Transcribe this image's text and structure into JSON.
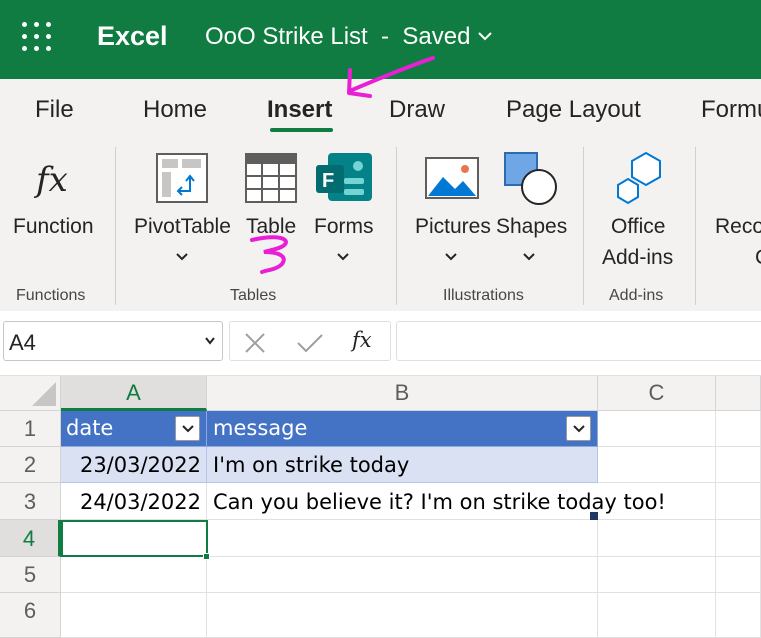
{
  "title_bar": {
    "app_name": "Excel",
    "doc_title": "OoO Strike List  -  Saved",
    "brand_color": "#107c41"
  },
  "ribbon_tabs": [
    {
      "label": "File",
      "active": false
    },
    {
      "label": "Home",
      "active": false
    },
    {
      "label": "Insert",
      "active": true
    },
    {
      "label": "Draw",
      "active": false
    },
    {
      "label": "Page Layout",
      "active": false
    },
    {
      "label": "Formu",
      "active": false
    }
  ],
  "ribbon": {
    "function_label": "Function",
    "pivottable_label": "PivotTable",
    "table_label": "Table",
    "forms_label": "Forms",
    "pictures_label": "Pictures",
    "shapes_label": "Shapes",
    "office_label": "Office",
    "addins_label": "Add-ins",
    "reco_label": "Reco",
    "reco_line2": "C",
    "groups": {
      "functions": "Functions",
      "tables": "Tables",
      "illustrations": "Illustrations",
      "addins": "Add-ins"
    }
  },
  "formula_bar": {
    "name_box": "A4",
    "formula": "",
    "fx_label": "fx"
  },
  "grid": {
    "columns": [
      "A",
      "B",
      "C"
    ],
    "rows": [
      "1",
      "2",
      "3",
      "4",
      "5",
      "6"
    ],
    "selected_cell": "A4",
    "table": {
      "header": [
        "date",
        "message"
      ],
      "rows": [
        [
          "23/03/2022",
          "I'm on strike today"
        ],
        [
          "24/03/2022",
          "Can you believe it? I'm on strike today too!"
        ]
      ],
      "header_color": "#4472c4",
      "band_color": "#d9e1f2"
    }
  },
  "annotations": {
    "color": "#e81fd5"
  }
}
